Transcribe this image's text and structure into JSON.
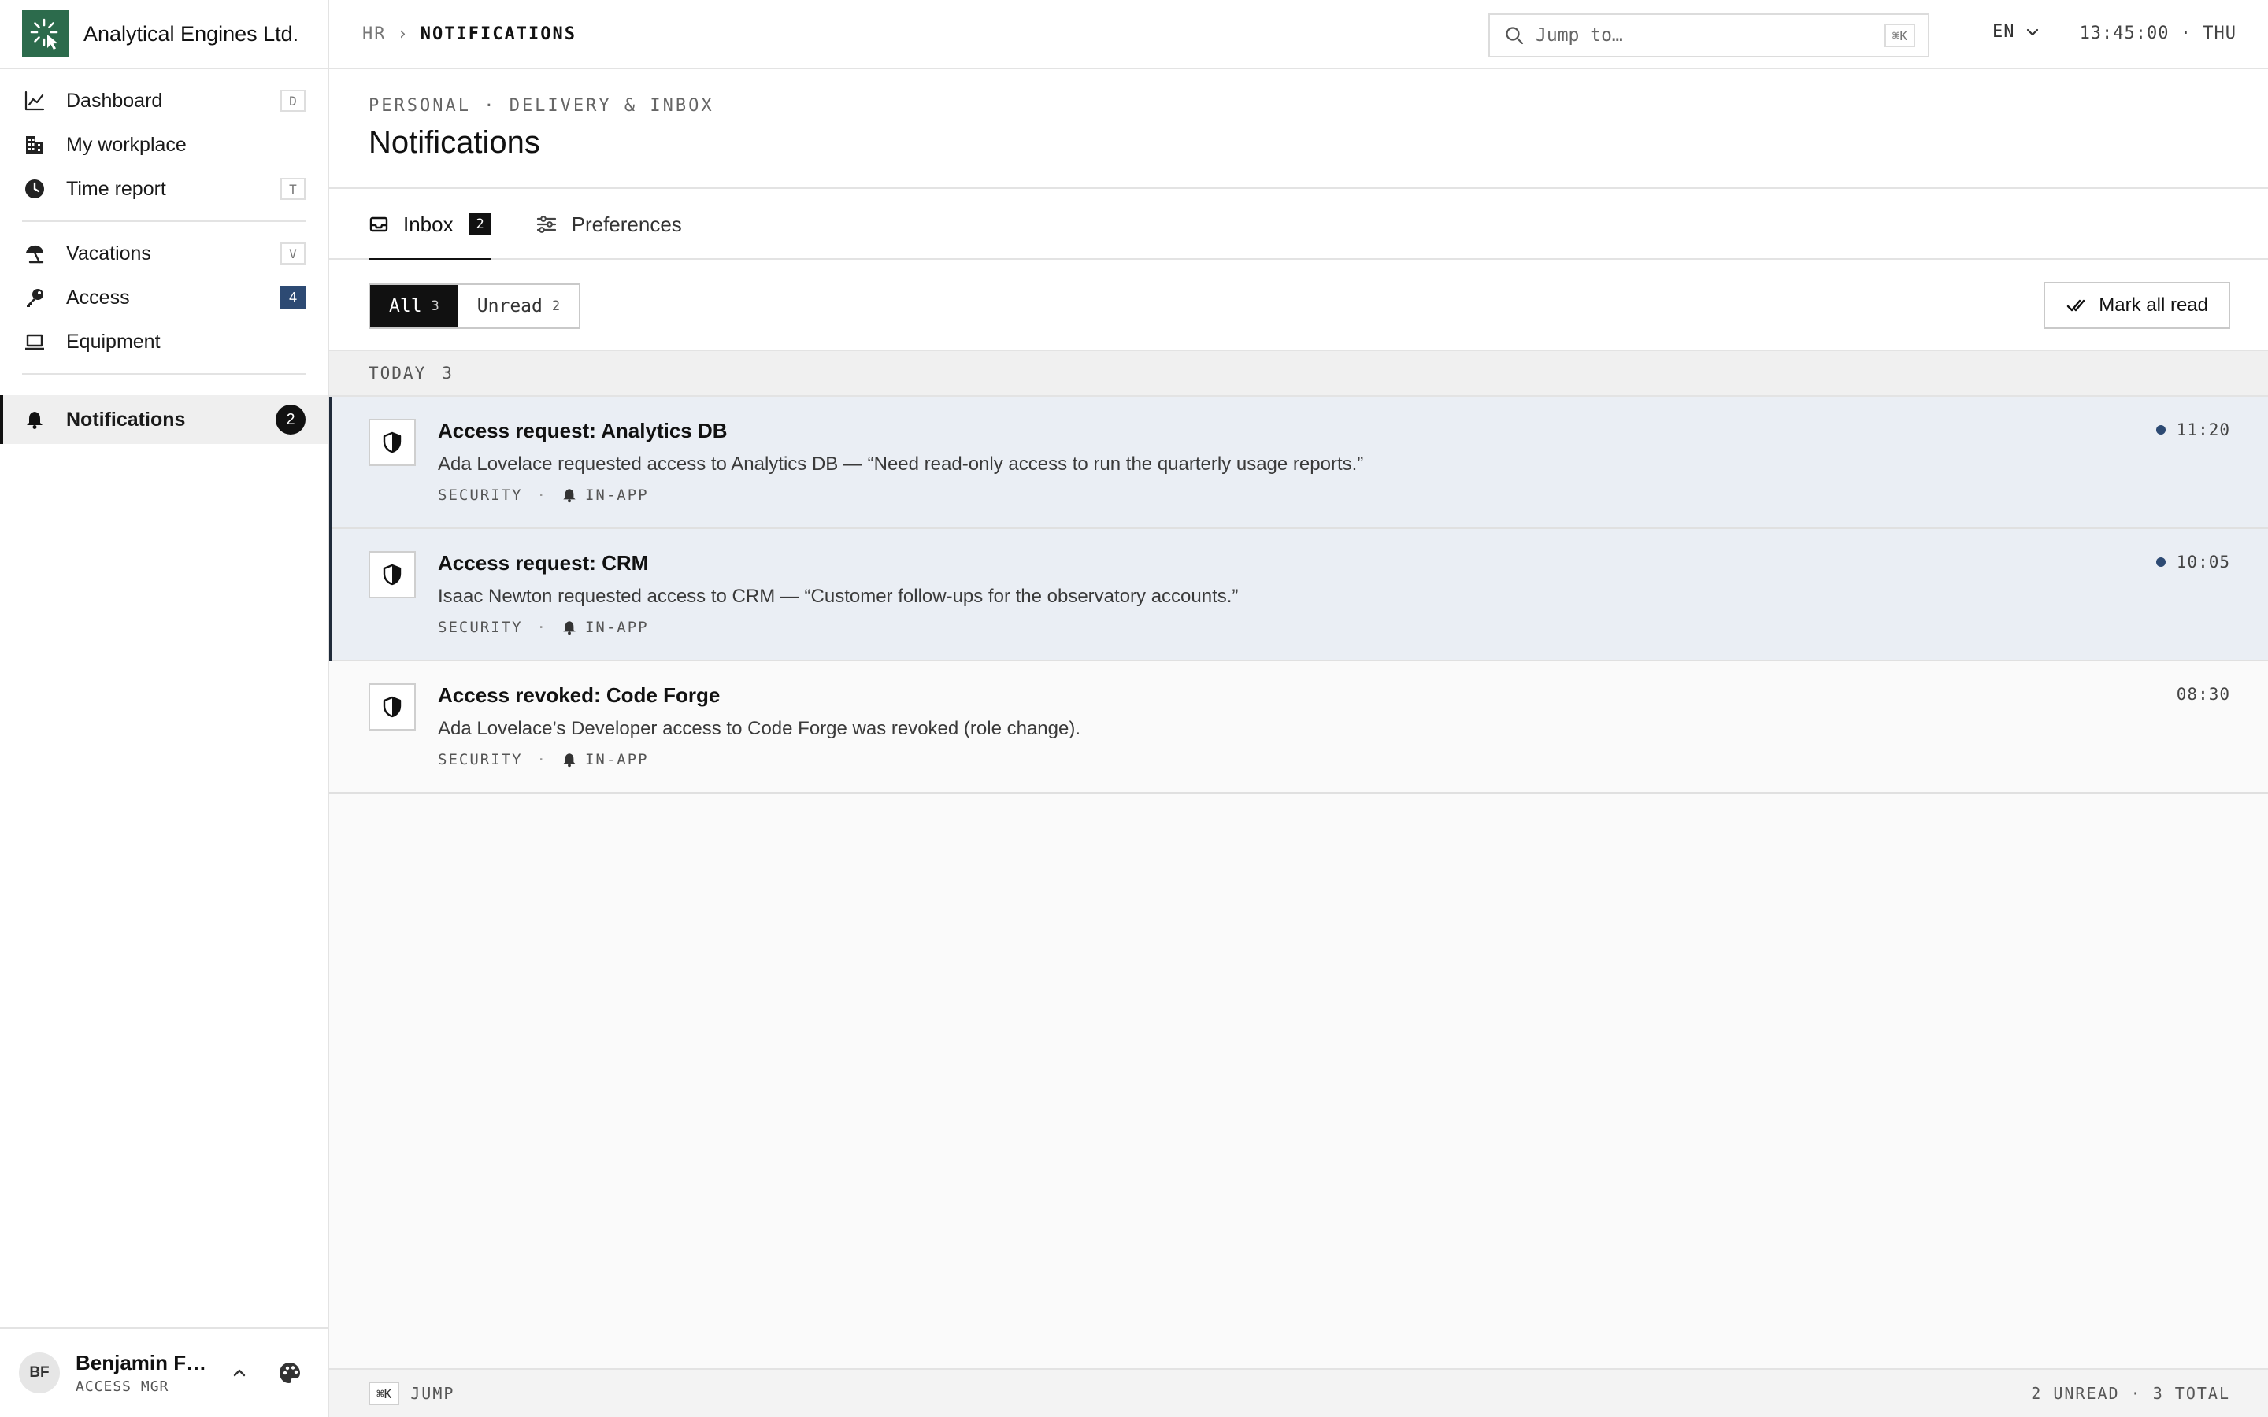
{
  "app": {
    "company": "Analytical Engines Ltd.",
    "brand_color": "#2c6b4c"
  },
  "sidebar": {
    "groups": [
      [
        {
          "label": "Dashboard",
          "icon": "chart-line-icon",
          "shortcut": "D"
        },
        {
          "label": "My workplace",
          "icon": "building-icon"
        },
        {
          "label": "Time report",
          "icon": "clock-icon",
          "shortcut": "T"
        }
      ],
      [
        {
          "label": "Vacations",
          "icon": "beach-umbrella-icon",
          "shortcut": "V"
        },
        {
          "label": "Access",
          "icon": "key-icon",
          "count": "4"
        },
        {
          "label": "Equipment",
          "icon": "laptop-icon"
        }
      ]
    ],
    "active": {
      "label": "Notifications",
      "icon": "bell-icon",
      "count": "2"
    },
    "user": {
      "initials": "BF",
      "name": "Benjamin Franklin",
      "role": "ACCESS MGR"
    }
  },
  "topbar": {
    "breadcrumb_root": "HR",
    "breadcrumb_sep": "›",
    "breadcrumb_current": "NOTIFICATIONS",
    "search_placeholder": "Jump to…",
    "search_shortcut": "⌘K",
    "language": "EN",
    "clock": "13:45:00 · THU"
  },
  "page": {
    "kicker": "PERSONAL · DELIVERY & INBOX",
    "title": "Notifications"
  },
  "tabs": [
    {
      "label": "Inbox",
      "badge": "2",
      "icon": "inbox-icon"
    },
    {
      "label": "Preferences",
      "icon": "sliders-icon"
    }
  ],
  "filters": {
    "all_label": "All",
    "all_count": "3",
    "unread_label": "Unread",
    "unread_count": "2",
    "mark_all": "Mark all read"
  },
  "groups": [
    {
      "label": "TODAY",
      "count": "3",
      "items": [
        {
          "title": "Access request: Analytics DB",
          "body": "Ada Lovelace requested access to Analytics DB — “Need read-only access to run the quarterly usage reports.”",
          "category": "SECURITY",
          "channel": "IN-APP",
          "time": "11:20",
          "unread": true
        },
        {
          "title": "Access request: CRM",
          "body": "Isaac Newton requested access to CRM — “Customer follow-ups for the observatory accounts.”",
          "category": "SECURITY",
          "channel": "IN-APP",
          "time": "10:05",
          "unread": true
        },
        {
          "title": "Access revoked: Code Forge",
          "body": "Ada Lovelace’s Developer access to Code Forge was revoked (role change).",
          "category": "SECURITY",
          "channel": "IN-APP",
          "time": "08:30",
          "unread": false
        }
      ]
    }
  ],
  "statusbar": {
    "shortcut": "⌘K",
    "jump": "JUMP",
    "totals": "2 UNREAD · 3 TOTAL"
  },
  "colors": {
    "unread_bg": "#eaeef4",
    "accent_navy": "#2d4a73",
    "ink": "#111111"
  }
}
